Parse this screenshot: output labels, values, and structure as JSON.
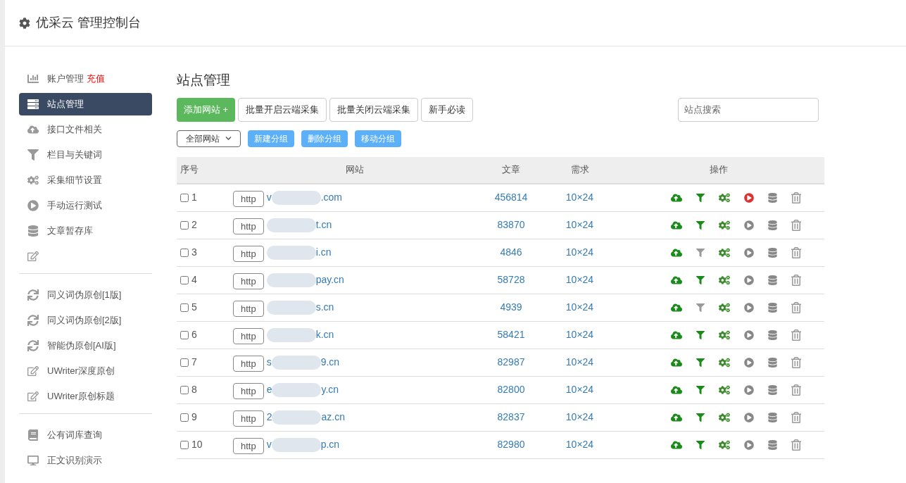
{
  "header": {
    "title": "优采云 管理控制台"
  },
  "sidebar": {
    "groups": [
      {
        "items": [
          {
            "label": "账户管理",
            "badge": "充值",
            "selected": false,
            "kind": "chart"
          },
          {
            "label": "站点管理",
            "selected": true,
            "kind": "server"
          },
          {
            "label": "接口文件相关",
            "selected": false,
            "kind": "cloud"
          },
          {
            "label": "栏目与关键词",
            "selected": false,
            "kind": "filter"
          },
          {
            "label": "采集细节设置",
            "selected": false,
            "kind": "cogs"
          },
          {
            "label": "手动运行测试",
            "selected": false,
            "kind": "play"
          },
          {
            "label": "文章暂存库",
            "selected": false,
            "kind": "database"
          },
          {
            "selected": false,
            "kind": "edit"
          }
        ]
      },
      {
        "items": [
          {
            "label": "同义词伪原创[1版]",
            "selected": false,
            "kind": "sync"
          },
          {
            "label": "同义词伪原创[2版]",
            "selected": false,
            "kind": "sync"
          },
          {
            "label": "智能伪原创[AI版]",
            "selected": false,
            "kind": "sync"
          },
          {
            "label": "UWriter深度原创",
            "selected": false,
            "kind": "edit"
          },
          {
            "label": "UWriter原创标题",
            "selected": false,
            "kind": "edit"
          }
        ]
      },
      {
        "items": [
          {
            "label": "公有词库查询",
            "selected": false,
            "kind": "book"
          },
          {
            "label": "正文识别演示",
            "selected": false,
            "kind": "desktop"
          }
        ]
      }
    ]
  },
  "page_title": "站点管理",
  "toolbar": {
    "add_button": "添加网站 +",
    "buttons": [
      "批量开启云端采集",
      "批量关闭云端采集",
      "新手必读"
    ],
    "search": {
      "placeholder": "站点搜索"
    }
  },
  "group_bar": {
    "select": "全部网站",
    "buttons": [
      "新建分组",
      "删除分组",
      "移动分组"
    ]
  },
  "table": {
    "columns": [
      "序号",
      "网站",
      "文章",
      "需求",
      "操作"
    ],
    "rows": [
      {
        "checked": false,
        "no": "1",
        "scheme": "http",
        "site_start": "v",
        "site_end": ".com",
        "articles": "456814",
        "demand": "10×24",
        "filter_on": true,
        "running": true
      },
      {
        "checked": false,
        "no": "2",
        "scheme": "http",
        "site_start": "",
        "site_end": "t.cn",
        "articles": "83870",
        "demand": "10×24",
        "filter_on": true,
        "running": false
      },
      {
        "checked": false,
        "no": "3",
        "scheme": "http",
        "site_start": "",
        "site_end": "i.cn",
        "articles": "4846",
        "demand": "10×24",
        "filter_on": false,
        "running": false
      },
      {
        "checked": false,
        "no": "4",
        "scheme": "http",
        "site_start": "",
        "site_end": "pay.cn",
        "articles": "58728",
        "demand": "10×24",
        "filter_on": true,
        "running": false
      },
      {
        "checked": false,
        "no": "5",
        "scheme": "http",
        "site_start": "",
        "site_end": "s.cn",
        "articles": "4939",
        "demand": "10×24",
        "filter_on": false,
        "running": false
      },
      {
        "checked": false,
        "no": "6",
        "scheme": "http",
        "site_start": "",
        "site_end": "k.cn",
        "articles": "58421",
        "demand": "10×24",
        "filter_on": true,
        "running": false
      },
      {
        "checked": false,
        "no": "7",
        "scheme": "http",
        "site_start": "s",
        "site_end": "9.cn",
        "articles": "82987",
        "demand": "10×24",
        "filter_on": true,
        "running": false
      },
      {
        "checked": false,
        "no": "8",
        "scheme": "http",
        "site_start": "e",
        "site_end": "y.cn",
        "articles": "82800",
        "demand": "10×24",
        "filter_on": true,
        "running": false
      },
      {
        "checked": false,
        "no": "9",
        "scheme": "http",
        "site_start": "2",
        "site_end": "az.cn",
        "articles": "82837",
        "demand": "10×24",
        "filter_on": true,
        "running": false
      },
      {
        "checked": false,
        "no": "10",
        "scheme": "http",
        "site_start": "v",
        "site_end": "p.cn",
        "articles": "82980",
        "demand": "10×24",
        "filter_on": true,
        "running": false
      }
    ]
  }
}
